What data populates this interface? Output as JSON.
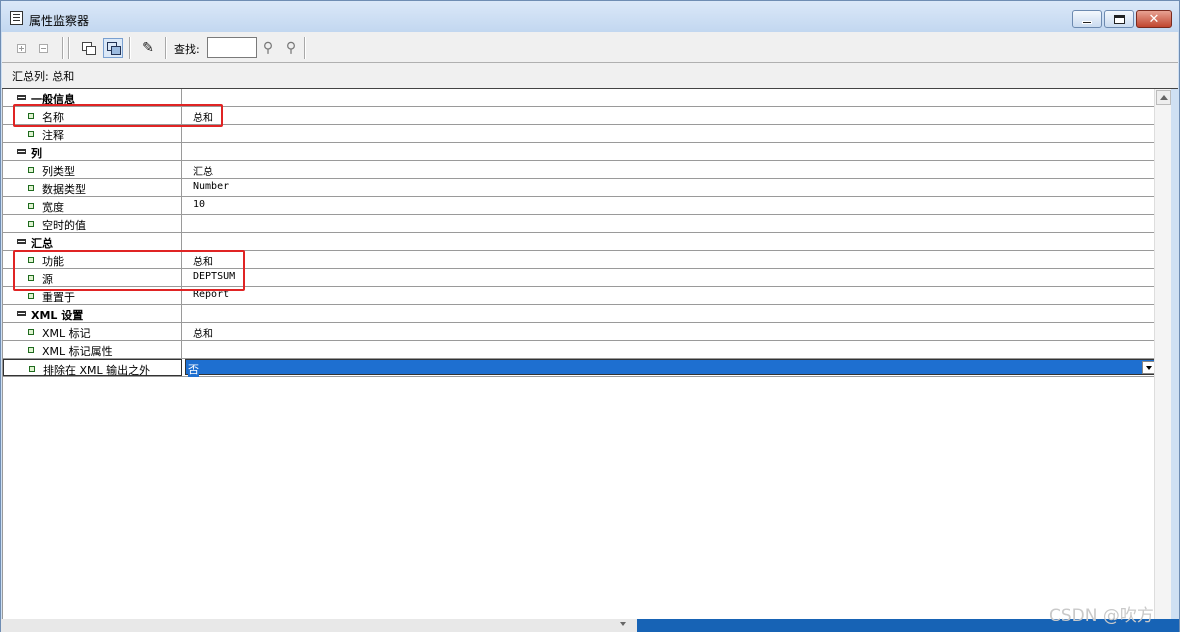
{
  "window": {
    "title": "属性监察器"
  },
  "toolbar": {
    "search_label": "查找:",
    "search_value": ""
  },
  "status": {
    "text": "汇总列: 总和"
  },
  "categories": [
    {
      "label": "一般信息",
      "props": [
        {
          "name": "名称",
          "value": "总和"
        },
        {
          "name": "注释",
          "value": ""
        }
      ]
    },
    {
      "label": "列",
      "props": [
        {
          "name": "列类型",
          "value": "汇总"
        },
        {
          "name": "数据类型",
          "value": "Number"
        },
        {
          "name": "宽度",
          "value": "10"
        },
        {
          "name": "空时的值",
          "value": ""
        }
      ]
    },
    {
      "label": "汇总",
      "props": [
        {
          "name": "功能",
          "value": "总和"
        },
        {
          "name": "源",
          "value": "DEPTSUM"
        },
        {
          "name": "重置于",
          "value": "Report"
        }
      ]
    },
    {
      "label": "XML 设置",
      "props": [
        {
          "name": "XML 标记",
          "value": "总和"
        },
        {
          "name": "XML 标记属性",
          "value": ""
        },
        {
          "name": "排除在 XML 输出之外",
          "value": "否"
        }
      ]
    }
  ],
  "watermark": "CSDN @吹方",
  "colors": {
    "highlight": "#e02424",
    "selection": "#1e6fd0",
    "titlebar": "#cfe0f3"
  }
}
